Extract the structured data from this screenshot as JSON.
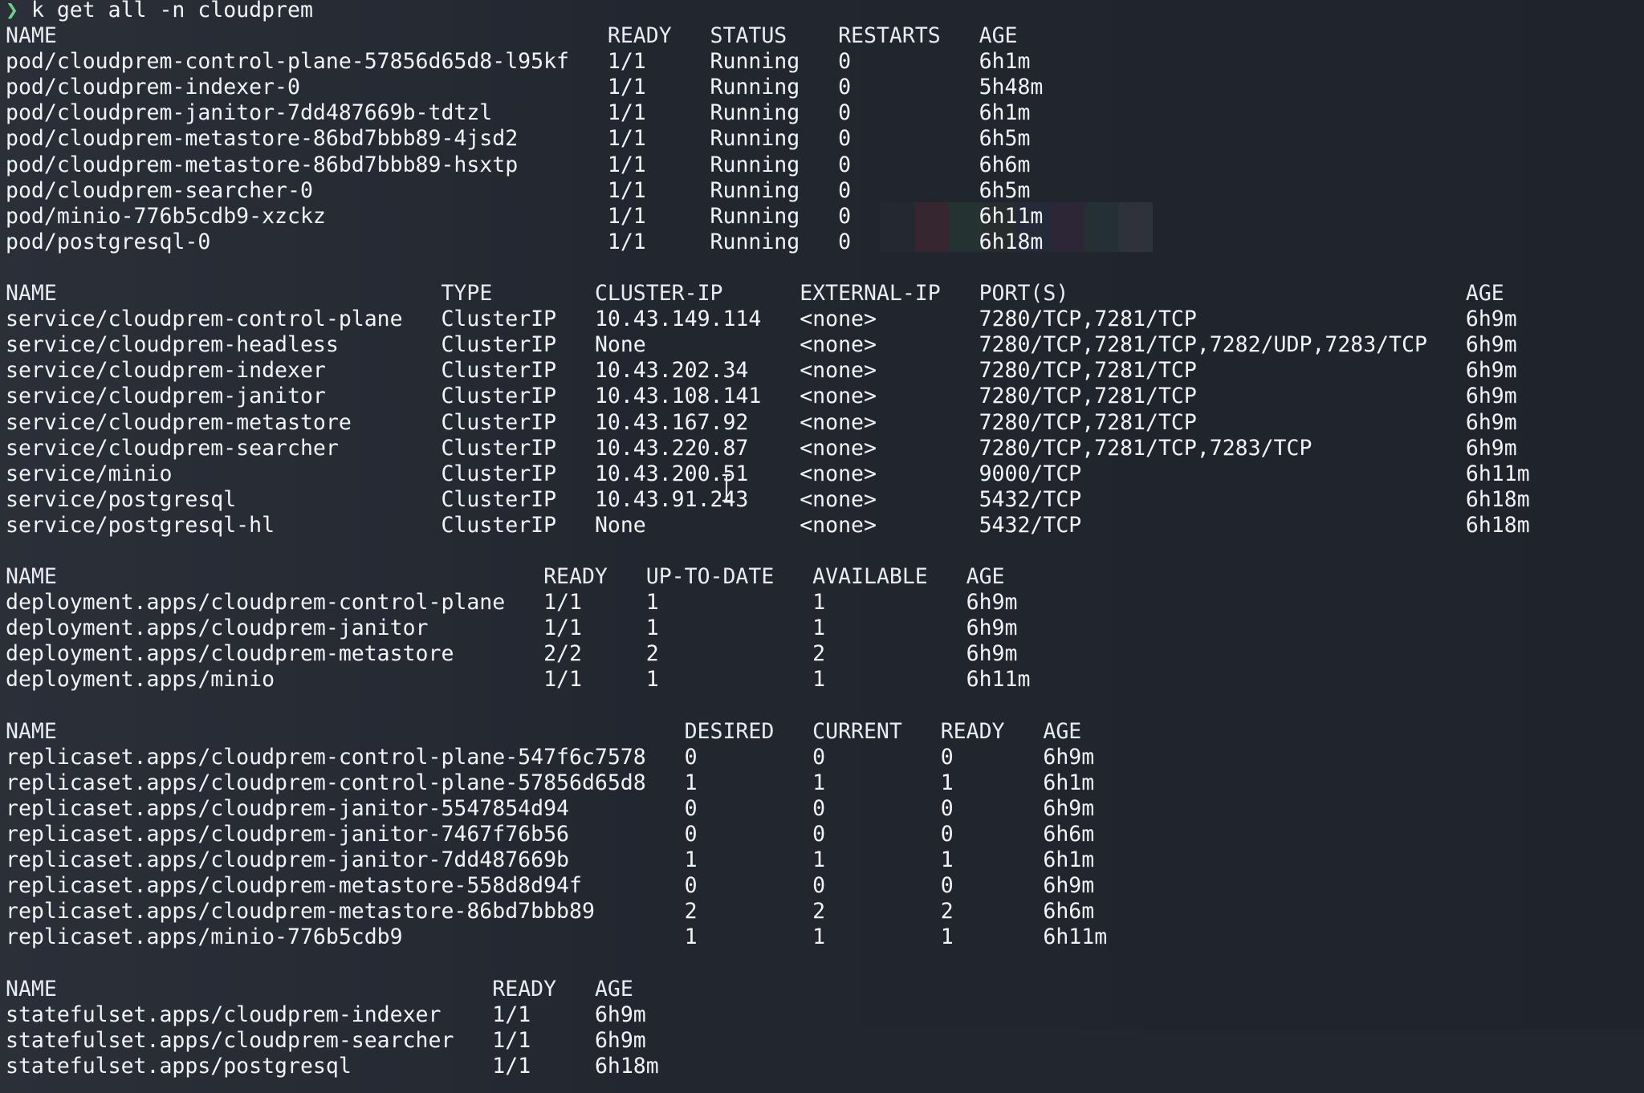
{
  "prompt": {
    "symbol": "❯",
    "command": "k get all -n cloudprem"
  },
  "pods": {
    "headers": {
      "name": "NAME",
      "ready": "READY",
      "status": "STATUS",
      "restarts": "RESTARTS",
      "age": "AGE"
    },
    "rows": [
      {
        "name": "pod/cloudprem-control-plane-57856d65d8-l95kf",
        "ready": "1/1",
        "status": "Running",
        "restarts": "0",
        "age": "6h1m"
      },
      {
        "name": "pod/cloudprem-indexer-0",
        "ready": "1/1",
        "status": "Running",
        "restarts": "0",
        "age": "5h48m"
      },
      {
        "name": "pod/cloudprem-janitor-7dd487669b-tdtzl",
        "ready": "1/1",
        "status": "Running",
        "restarts": "0",
        "age": "6h1m"
      },
      {
        "name": "pod/cloudprem-metastore-86bd7bbb89-4jsd2",
        "ready": "1/1",
        "status": "Running",
        "restarts": "0",
        "age": "6h5m"
      },
      {
        "name": "pod/cloudprem-metastore-86bd7bbb89-hsxtp",
        "ready": "1/1",
        "status": "Running",
        "restarts": "0",
        "age": "6h6m"
      },
      {
        "name": "pod/cloudprem-searcher-0",
        "ready": "1/1",
        "status": "Running",
        "restarts": "0",
        "age": "6h5m"
      },
      {
        "name": "pod/minio-776b5cdb9-xzckz",
        "ready": "1/1",
        "status": "Running",
        "restarts": "0",
        "age": "6h11m"
      },
      {
        "name": "pod/postgresql-0",
        "ready": "1/1",
        "status": "Running",
        "restarts": "0",
        "age": "6h18m"
      }
    ]
  },
  "services": {
    "headers": {
      "name": "NAME",
      "type": "TYPE",
      "cluster_ip": "CLUSTER-IP",
      "external_ip": "EXTERNAL-IP",
      "ports": "PORT(S)",
      "age": "AGE"
    },
    "rows": [
      {
        "name": "service/cloudprem-control-plane",
        "type": "ClusterIP",
        "cluster_ip": "10.43.149.114",
        "external_ip": "<none>",
        "ports": "7280/TCP,7281/TCP",
        "age": "6h9m"
      },
      {
        "name": "service/cloudprem-headless",
        "type": "ClusterIP",
        "cluster_ip": "None",
        "external_ip": "<none>",
        "ports": "7280/TCP,7281/TCP,7282/UDP,7283/TCP",
        "age": "6h9m"
      },
      {
        "name": "service/cloudprem-indexer",
        "type": "ClusterIP",
        "cluster_ip": "10.43.202.34",
        "external_ip": "<none>",
        "ports": "7280/TCP,7281/TCP",
        "age": "6h9m"
      },
      {
        "name": "service/cloudprem-janitor",
        "type": "ClusterIP",
        "cluster_ip": "10.43.108.141",
        "external_ip": "<none>",
        "ports": "7280/TCP,7281/TCP",
        "age": "6h9m"
      },
      {
        "name": "service/cloudprem-metastore",
        "type": "ClusterIP",
        "cluster_ip": "10.43.167.92",
        "external_ip": "<none>",
        "ports": "7280/TCP,7281/TCP",
        "age": "6h9m"
      },
      {
        "name": "service/cloudprem-searcher",
        "type": "ClusterIP",
        "cluster_ip": "10.43.220.87",
        "external_ip": "<none>",
        "ports": "7280/TCP,7281/TCP,7283/TCP",
        "age": "6h9m"
      },
      {
        "name": "service/minio",
        "type": "ClusterIP",
        "cluster_ip": "10.43.200.51",
        "external_ip": "<none>",
        "ports": "9000/TCP",
        "age": "6h11m"
      },
      {
        "name": "service/postgresql",
        "type": "ClusterIP",
        "cluster_ip": "10.43.91.243",
        "external_ip": "<none>",
        "ports": "5432/TCP",
        "age": "6h18m"
      },
      {
        "name": "service/postgresql-hl",
        "type": "ClusterIP",
        "cluster_ip": "None",
        "external_ip": "<none>",
        "ports": "5432/TCP",
        "age": "6h18m"
      }
    ]
  },
  "deployments": {
    "headers": {
      "name": "NAME",
      "ready": "READY",
      "up_to_date": "UP-TO-DATE",
      "available": "AVAILABLE",
      "age": "AGE"
    },
    "rows": [
      {
        "name": "deployment.apps/cloudprem-control-plane",
        "ready": "1/1",
        "up_to_date": "1",
        "available": "1",
        "age": "6h9m"
      },
      {
        "name": "deployment.apps/cloudprem-janitor",
        "ready": "1/1",
        "up_to_date": "1",
        "available": "1",
        "age": "6h9m"
      },
      {
        "name": "deployment.apps/cloudprem-metastore",
        "ready": "2/2",
        "up_to_date": "2",
        "available": "2",
        "age": "6h9m"
      },
      {
        "name": "deployment.apps/minio",
        "ready": "1/1",
        "up_to_date": "1",
        "available": "1",
        "age": "6h11m"
      }
    ]
  },
  "replicasets": {
    "headers": {
      "name": "NAME",
      "desired": "DESIRED",
      "current": "CURRENT",
      "ready": "READY",
      "age": "AGE"
    },
    "rows": [
      {
        "name": "replicaset.apps/cloudprem-control-plane-547f6c7578",
        "desired": "0",
        "current": "0",
        "ready": "0",
        "age": "6h9m"
      },
      {
        "name": "replicaset.apps/cloudprem-control-plane-57856d65d8",
        "desired": "1",
        "current": "1",
        "ready": "1",
        "age": "6h1m"
      },
      {
        "name": "replicaset.apps/cloudprem-janitor-5547854d94",
        "desired": "0",
        "current": "0",
        "ready": "0",
        "age": "6h9m"
      },
      {
        "name": "replicaset.apps/cloudprem-janitor-7467f76b56",
        "desired": "0",
        "current": "0",
        "ready": "0",
        "age": "6h6m"
      },
      {
        "name": "replicaset.apps/cloudprem-janitor-7dd487669b",
        "desired": "1",
        "current": "1",
        "ready": "1",
        "age": "6h1m"
      },
      {
        "name": "replicaset.apps/cloudprem-metastore-558d8d94f",
        "desired": "0",
        "current": "0",
        "ready": "0",
        "age": "6h9m"
      },
      {
        "name": "replicaset.apps/cloudprem-metastore-86bd7bbb89",
        "desired": "2",
        "current": "2",
        "ready": "2",
        "age": "6h6m"
      },
      {
        "name": "replicaset.apps/minio-776b5cdb9",
        "desired": "1",
        "current": "1",
        "ready": "1",
        "age": "6h11m"
      }
    ]
  },
  "statefulsets": {
    "headers": {
      "name": "NAME",
      "ready": "READY",
      "age": "AGE"
    },
    "rows": [
      {
        "name": "statefulset.apps/cloudprem-indexer",
        "ready": "1/1",
        "age": "6h9m"
      },
      {
        "name": "statefulset.apps/cloudprem-searcher",
        "ready": "1/1",
        "age": "6h9m"
      },
      {
        "name": "statefulset.apps/postgresql",
        "ready": "1/1",
        "age": "6h18m"
      }
    ]
  },
  "colors": {
    "prompt_symbol": "#6fd08c",
    "text": "#f2f4f8",
    "background": "#22262f"
  }
}
